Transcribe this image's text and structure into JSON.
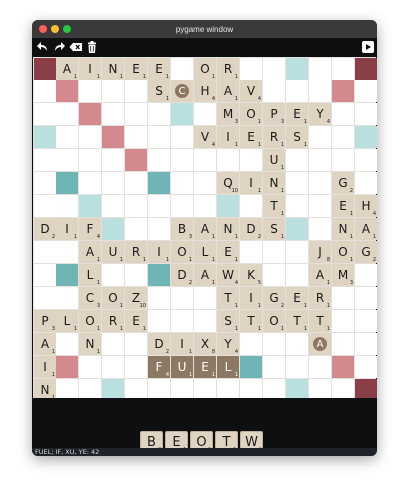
{
  "window": {
    "title": "pygame window",
    "controls": {
      "close_color": "#ff5f57",
      "minimize_color": "#febc2e",
      "zoom_color": "#28c840"
    }
  },
  "toolbar": {
    "icons": [
      "undo-icon",
      "redo-icon",
      "backspace-icon",
      "trash-icon",
      "play-icon"
    ]
  },
  "colors": {
    "triple_word": "#8a3e48",
    "double_word": "#d3898e",
    "triple_letter": "#70b5b6",
    "double_letter": "#b9e0df",
    "tile": "#dfd3c1",
    "pending_tile": "#8c7863"
  },
  "board": {
    "size": 15,
    "premiums": {
      "tw": [
        [
          0,
          0
        ],
        [
          0,
          14
        ],
        [
          14,
          0
        ],
        [
          14,
          14
        ]
      ],
      "dw": [
        [
          1,
          1
        ],
        [
          1,
          13
        ],
        [
          2,
          2
        ],
        [
          3,
          3
        ],
        [
          4,
          4
        ],
        [
          13,
          1
        ],
        [
          13,
          13
        ]
      ],
      "tl": [
        [
          5,
          1
        ],
        [
          5,
          5
        ],
        [
          5,
          9
        ],
        [
          9,
          1
        ],
        [
          9,
          5
        ],
        [
          9,
          13
        ],
        [
          13,
          9
        ]
      ],
      "dl": [
        [
          0,
          11
        ],
        [
          2,
          6
        ],
        [
          3,
          0
        ],
        [
          3,
          14
        ],
        [
          6,
          2
        ],
        [
          6,
          8
        ],
        [
          7,
          0
        ],
        [
          7,
          3
        ],
        [
          7,
          7
        ],
        [
          7,
          11
        ],
        [
          12,
          7
        ],
        [
          14,
          3
        ],
        [
          14,
          11
        ]
      ]
    },
    "tiles": [
      {
        "r": 0,
        "c": 1,
        "l": "A",
        "p": "1"
      },
      {
        "r": 0,
        "c": 2,
        "l": "I",
        "p": "1"
      },
      {
        "r": 0,
        "c": 3,
        "l": "N",
        "p": "1"
      },
      {
        "r": 0,
        "c": 4,
        "l": "E",
        "p": "1"
      },
      {
        "r": 0,
        "c": 5,
        "l": "E",
        "p": "1"
      },
      {
        "r": 0,
        "c": 7,
        "l": "O",
        "p": "1"
      },
      {
        "r": 0,
        "c": 8,
        "l": "R",
        "p": "1"
      },
      {
        "r": 1,
        "c": 5,
        "l": "S",
        "p": "1"
      },
      {
        "r": 1,
        "c": 6,
        "l": "C",
        "p": "",
        "blank": true
      },
      {
        "r": 1,
        "c": 7,
        "l": "H",
        "p": "4"
      },
      {
        "r": 1,
        "c": 8,
        "l": "A",
        "p": "1"
      },
      {
        "r": 1,
        "c": 9,
        "l": "V",
        "p": "4"
      },
      {
        "r": 2,
        "c": 8,
        "l": "M",
        "p": "3"
      },
      {
        "r": 2,
        "c": 9,
        "l": "O",
        "p": "1"
      },
      {
        "r": 2,
        "c": 10,
        "l": "P",
        "p": "3"
      },
      {
        "r": 2,
        "c": 11,
        "l": "E",
        "p": "1"
      },
      {
        "r": 2,
        "c": 12,
        "l": "Y",
        "p": "4"
      },
      {
        "r": 3,
        "c": 7,
        "l": "V",
        "p": "4"
      },
      {
        "r": 3,
        "c": 8,
        "l": "I",
        "p": "1"
      },
      {
        "r": 3,
        "c": 9,
        "l": "E",
        "p": "1"
      },
      {
        "r": 3,
        "c": 10,
        "l": "R",
        "p": "1"
      },
      {
        "r": 3,
        "c": 11,
        "l": "S",
        "p": "1"
      },
      {
        "r": 4,
        "c": 10,
        "l": "U",
        "p": "1"
      },
      {
        "r": 5,
        "c": 8,
        "l": "Q",
        "p": "10"
      },
      {
        "r": 5,
        "c": 9,
        "l": "I",
        "p": "1"
      },
      {
        "r": 5,
        "c": 10,
        "l": "N",
        "p": "1"
      },
      {
        "r": 5,
        "c": 13,
        "l": "G",
        "p": "2"
      },
      {
        "r": 6,
        "c": 10,
        "l": "T",
        "p": "1"
      },
      {
        "r": 6,
        "c": 13,
        "l": "E",
        "p": "1"
      },
      {
        "r": 6,
        "c": 14,
        "l": "H",
        "p": "4"
      },
      {
        "r": 7,
        "c": 0,
        "l": "D",
        "p": "2"
      },
      {
        "r": 7,
        "c": 1,
        "l": "I",
        "p": "1"
      },
      {
        "r": 7,
        "c": 2,
        "l": "F",
        "p": "4"
      },
      {
        "r": 7,
        "c": 6,
        "l": "B",
        "p": "3"
      },
      {
        "r": 7,
        "c": 7,
        "l": "A",
        "p": "1"
      },
      {
        "r": 7,
        "c": 8,
        "l": "N",
        "p": "1"
      },
      {
        "r": 7,
        "c": 9,
        "l": "D",
        "p": "2"
      },
      {
        "r": 7,
        "c": 10,
        "l": "S",
        "p": "1"
      },
      {
        "r": 7,
        "c": 13,
        "l": "N",
        "p": "1"
      },
      {
        "r": 7,
        "c": 14,
        "l": "A",
        "p": "1"
      },
      {
        "r": 8,
        "c": 2,
        "l": "A",
        "p": "1"
      },
      {
        "r": 8,
        "c": 3,
        "l": "U",
        "p": "1"
      },
      {
        "r": 8,
        "c": 4,
        "l": "R",
        "p": "1"
      },
      {
        "r": 8,
        "c": 5,
        "l": "I",
        "p": "1"
      },
      {
        "r": 8,
        "c": 6,
        "l": "O",
        "p": "1"
      },
      {
        "r": 8,
        "c": 7,
        "l": "L",
        "p": "1"
      },
      {
        "r": 8,
        "c": 8,
        "l": "E",
        "p": "1"
      },
      {
        "r": 8,
        "c": 12,
        "l": "J",
        "p": "8"
      },
      {
        "r": 8,
        "c": 13,
        "l": "O",
        "p": "1"
      },
      {
        "r": 8,
        "c": 14,
        "l": "G",
        "p": "2"
      },
      {
        "r": 9,
        "c": 2,
        "l": "L",
        "p": "1"
      },
      {
        "r": 9,
        "c": 6,
        "l": "D",
        "p": "2"
      },
      {
        "r": 9,
        "c": 7,
        "l": "A",
        "p": "1"
      },
      {
        "r": 9,
        "c": 8,
        "l": "W",
        "p": "4"
      },
      {
        "r": 9,
        "c": 9,
        "l": "K",
        "p": "5"
      },
      {
        "r": 9,
        "c": 12,
        "l": "A",
        "p": "1"
      },
      {
        "r": 9,
        "c": 13,
        "l": "M",
        "p": "3"
      },
      {
        "r": 10,
        "c": 2,
        "l": "C",
        "p": "3"
      },
      {
        "r": 10,
        "c": 3,
        "l": "O",
        "p": "1"
      },
      {
        "r": 10,
        "c": 4,
        "l": "Z",
        "p": "10"
      },
      {
        "r": 10,
        "c": 8,
        "l": "T",
        "p": "1"
      },
      {
        "r": 10,
        "c": 9,
        "l": "I",
        "p": "1"
      },
      {
        "r": 10,
        "c": 10,
        "l": "G",
        "p": "2"
      },
      {
        "r": 10,
        "c": 11,
        "l": "E",
        "p": "1"
      },
      {
        "r": 10,
        "c": 12,
        "l": "R",
        "p": "1"
      },
      {
        "r": 11,
        "c": 0,
        "l": "P",
        "p": "3"
      },
      {
        "r": 11,
        "c": 1,
        "l": "L",
        "p": "1"
      },
      {
        "r": 11,
        "c": 2,
        "l": "O",
        "p": "1"
      },
      {
        "r": 11,
        "c": 3,
        "l": "R",
        "p": "1"
      },
      {
        "r": 11,
        "c": 4,
        "l": "E",
        "p": "1"
      },
      {
        "r": 11,
        "c": 8,
        "l": "S",
        "p": "1"
      },
      {
        "r": 11,
        "c": 9,
        "l": "T",
        "p": "1"
      },
      {
        "r": 11,
        "c": 10,
        "l": "O",
        "p": "1"
      },
      {
        "r": 11,
        "c": 11,
        "l": "T",
        "p": "1"
      },
      {
        "r": 11,
        "c": 12,
        "l": "T",
        "p": "1"
      },
      {
        "r": 12,
        "c": 0,
        "l": "A",
        "p": "1"
      },
      {
        "r": 12,
        "c": 2,
        "l": "N",
        "p": "1"
      },
      {
        "r": 12,
        "c": 5,
        "l": "D",
        "p": "2"
      },
      {
        "r": 12,
        "c": 6,
        "l": "I",
        "p": "1"
      },
      {
        "r": 12,
        "c": 7,
        "l": "X",
        "p": "8"
      },
      {
        "r": 12,
        "c": 8,
        "l": "Y",
        "p": "4"
      },
      {
        "r": 12,
        "c": 12,
        "l": "A",
        "p": "",
        "blank": true
      },
      {
        "r": 13,
        "c": 0,
        "l": "I",
        "p": "1"
      },
      {
        "r": 13,
        "c": 5,
        "l": "F",
        "p": "4",
        "pending": true
      },
      {
        "r": 13,
        "c": 6,
        "l": "U",
        "p": "1",
        "pending": true
      },
      {
        "r": 13,
        "c": 7,
        "l": "E",
        "p": "1",
        "pending": true
      },
      {
        "r": 13,
        "c": 8,
        "l": "L",
        "p": "1",
        "pending": true
      },
      {
        "r": 14,
        "c": 0,
        "l": "N",
        "p": "1"
      }
    ]
  },
  "rack": [
    {
      "l": "B",
      "p": "3"
    },
    {
      "l": "E",
      "p": "1"
    },
    {
      "l": "O",
      "p": "1"
    },
    {
      "l": "T",
      "p": "1"
    },
    {
      "l": "W",
      "p": "4"
    }
  ],
  "status": "FUEL; IF, XU, YE: 42"
}
